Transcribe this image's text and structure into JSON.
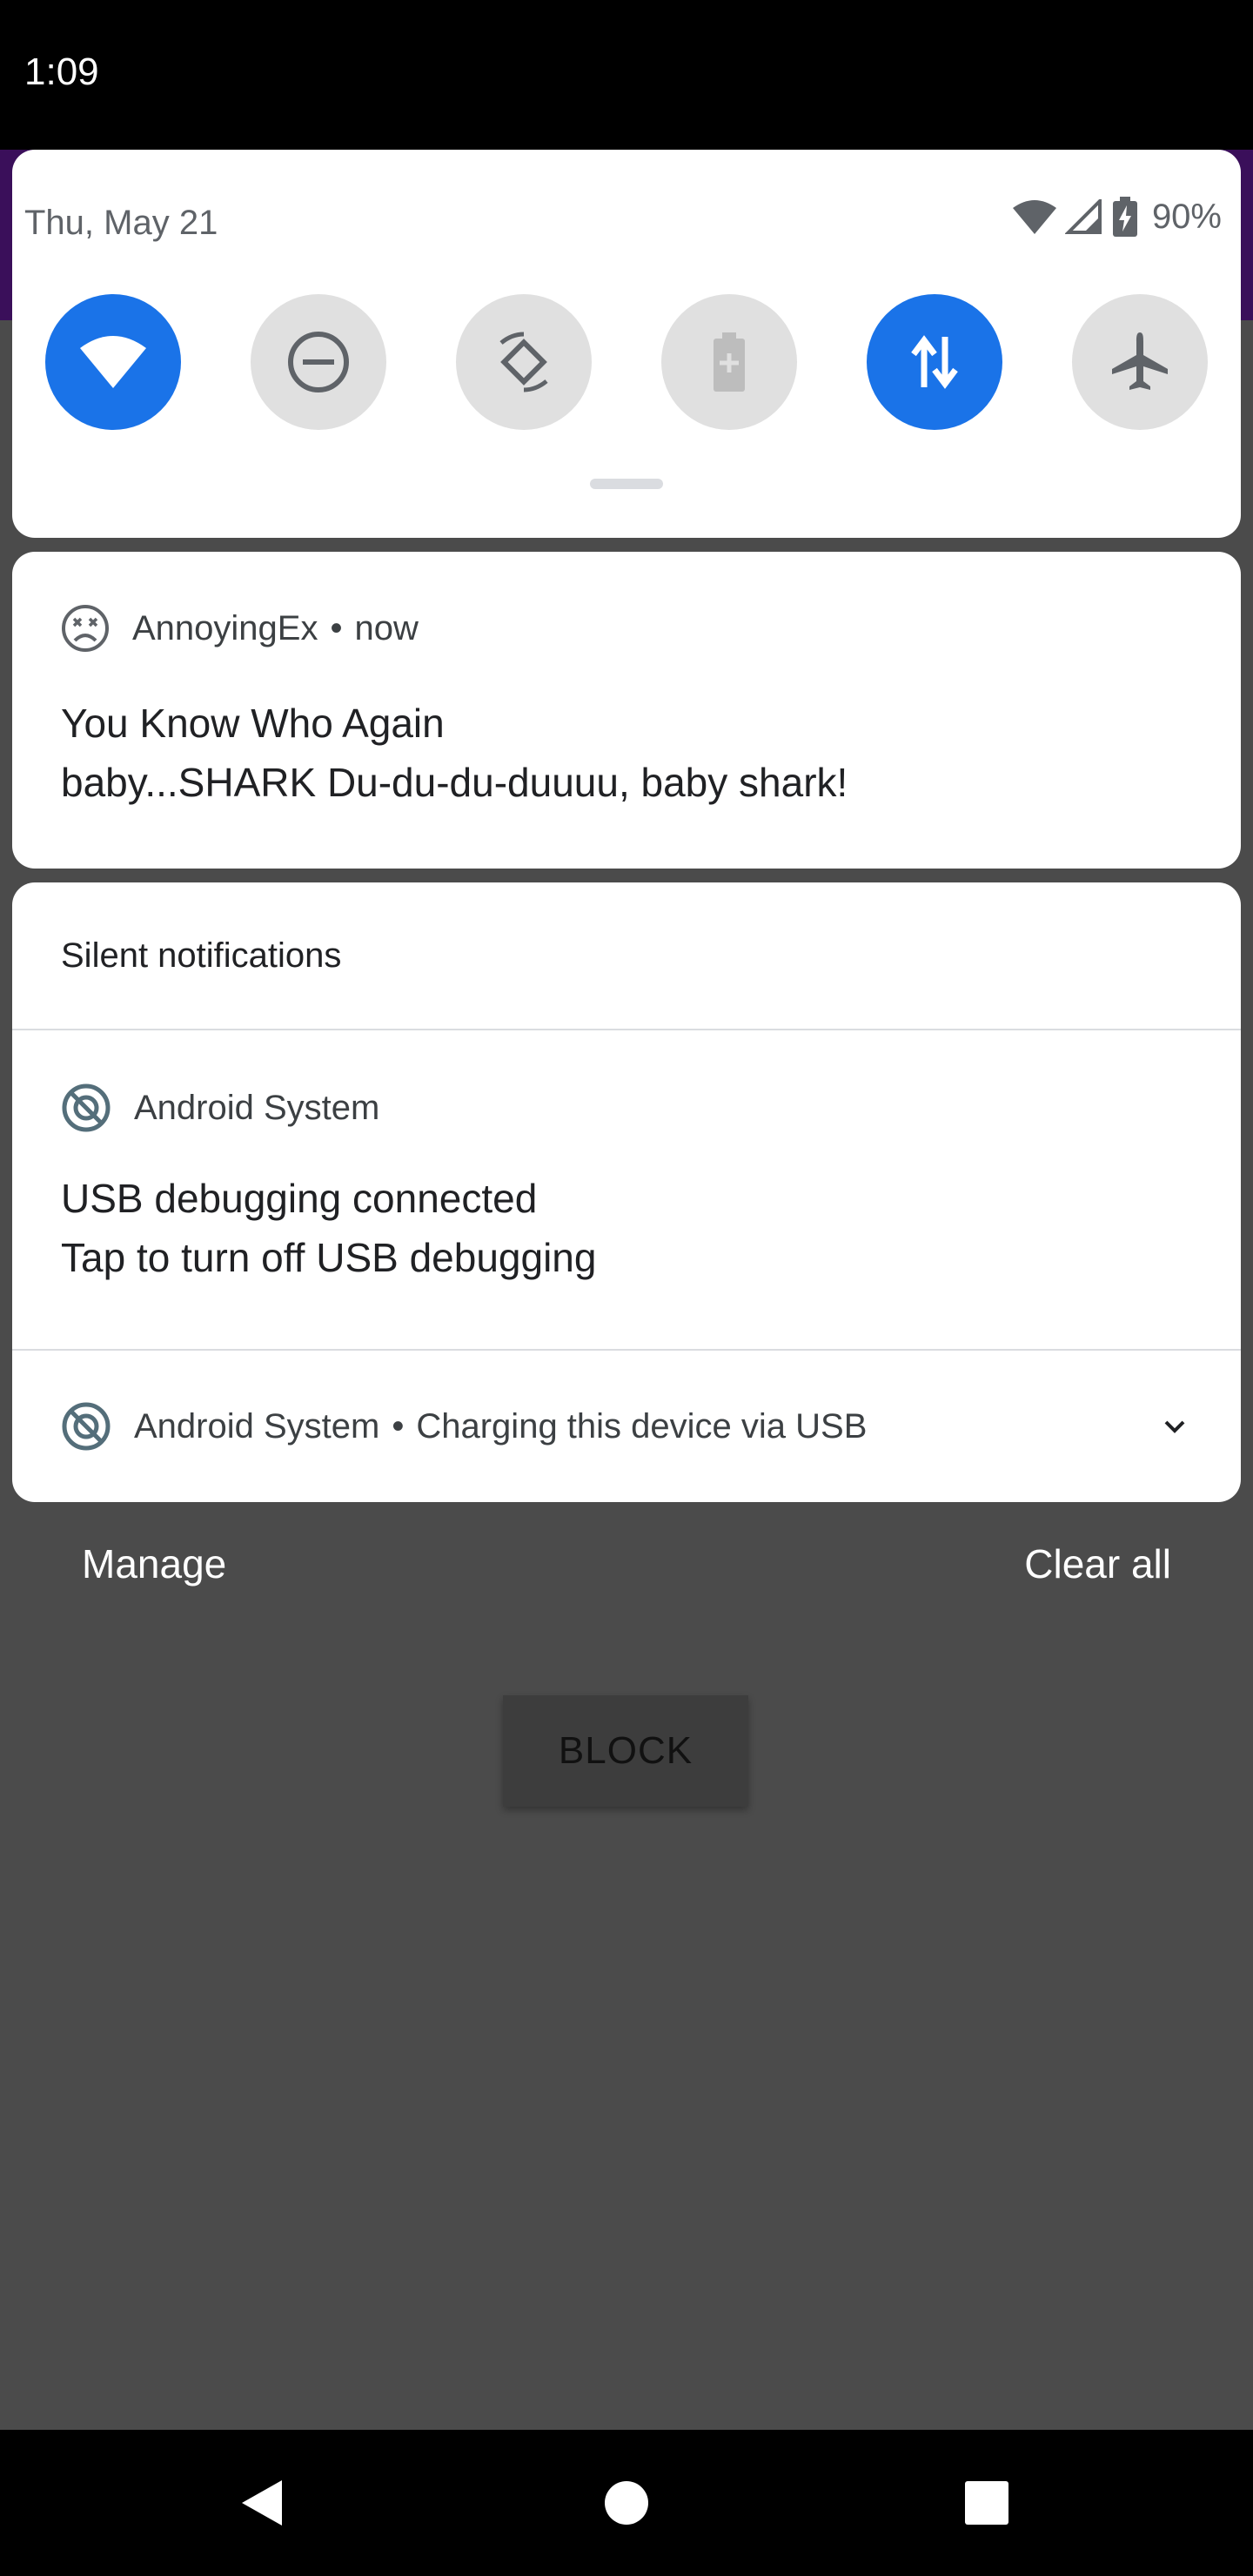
{
  "status_bar": {
    "time": "1:09"
  },
  "quick_settings": {
    "date": "Thu, May 21",
    "battery_percent": "90%",
    "tiles": [
      {
        "name": "wifi",
        "icon": "wifi-icon",
        "active": true
      },
      {
        "name": "do-not-disturb",
        "icon": "do-not-disturb-icon",
        "active": false
      },
      {
        "name": "auto-rotate",
        "icon": "auto-rotate-icon",
        "active": false
      },
      {
        "name": "battery-saver",
        "icon": "battery-saver-icon",
        "active": false
      },
      {
        "name": "mobile-data",
        "icon": "data-arrows-icon",
        "active": true
      },
      {
        "name": "airplane-mode",
        "icon": "airplane-icon",
        "active": false
      }
    ]
  },
  "notification_1": {
    "app_name": "AnnoyingEx",
    "separator": "•",
    "time": "now",
    "title": "You Know Who Again",
    "text": "baby...SHARK Du-du-du-duuuu, baby shark!"
  },
  "silent_section": {
    "header": "Silent notifications",
    "items": [
      {
        "app_name": "Android System",
        "title": "USB debugging connected",
        "text": "Tap to turn off USB debugging"
      },
      {
        "app_name": "Android System",
        "separator": "•",
        "summary": "Charging this device via USB"
      }
    ]
  },
  "footer": {
    "manage": "Manage",
    "clear_all": "Clear all"
  },
  "app_background": {
    "block_button": "BLOCK"
  },
  "colors": {
    "accent": "#1a73e8",
    "scrim": "#4b4b4b"
  }
}
